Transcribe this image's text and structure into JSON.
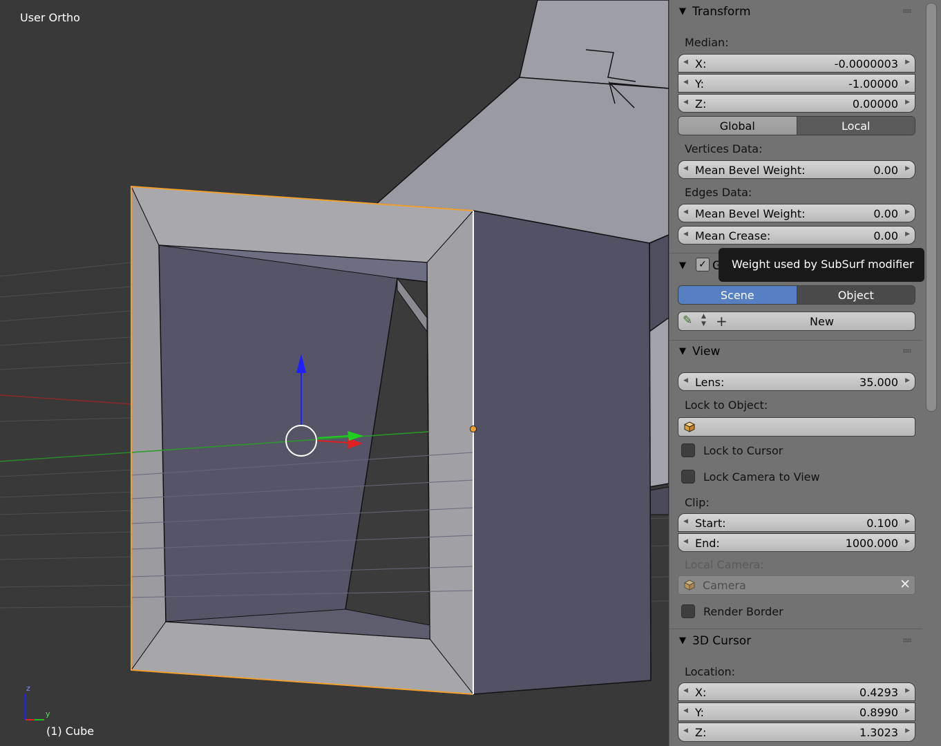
{
  "viewport": {
    "view_name": "User Ortho",
    "object_info": "(1) Cube",
    "axes": {
      "z": "z",
      "y": "y"
    }
  },
  "transform": {
    "title": "Transform",
    "median_label": "Median:",
    "x_label": "X:",
    "x_value": "-0.0000003",
    "y_label": "Y:",
    "y_value": "-1.00000",
    "z_label": "Z:",
    "z_value": "0.00000",
    "global_label": "Global",
    "local_label": "Local",
    "vertices_data_label": "Vertices Data:",
    "vert_bevel_label": "Mean Bevel Weight:",
    "vert_bevel_value": "0.00",
    "edges_data_label": "Edges Data:",
    "edge_bevel_label": "Mean Bevel Weight:",
    "edge_bevel_value": "0.00",
    "crease_label": "Mean Crease:",
    "crease_value": "0.00"
  },
  "grease_pencil": {
    "title_fragment": "G",
    "scene_label": "Scene",
    "object_label": "Object",
    "new_label": "New"
  },
  "tooltip": {
    "text": "Weight used by SubSurf modifier"
  },
  "view": {
    "title": "View",
    "lens_label": "Lens:",
    "lens_value": "35.000",
    "lock_to_object_label": "Lock to Object:",
    "lock_to_cursor_label": "Lock to Cursor",
    "lock_camera_label": "Lock Camera to View",
    "clip_label": "Clip:",
    "start_label": "Start:",
    "start_value": "0.100",
    "end_label": "End:",
    "end_value": "1000.000",
    "local_camera_label": "Local Camera:",
    "camera_value": "Camera",
    "render_border_label": "Render Border"
  },
  "cursor3d": {
    "title": "3D Cursor",
    "location_label": "Location:",
    "x_label": "X:",
    "x_value": "0.4293",
    "y_label": "Y:",
    "y_value": "0.8990",
    "z_label": "Z:",
    "z_value": "1.3023"
  },
  "colors": {
    "viewport_bg": "#393939",
    "panel_bg": "#727272",
    "selected_edge": "#f0a030",
    "active_blue": "#5680c2"
  }
}
